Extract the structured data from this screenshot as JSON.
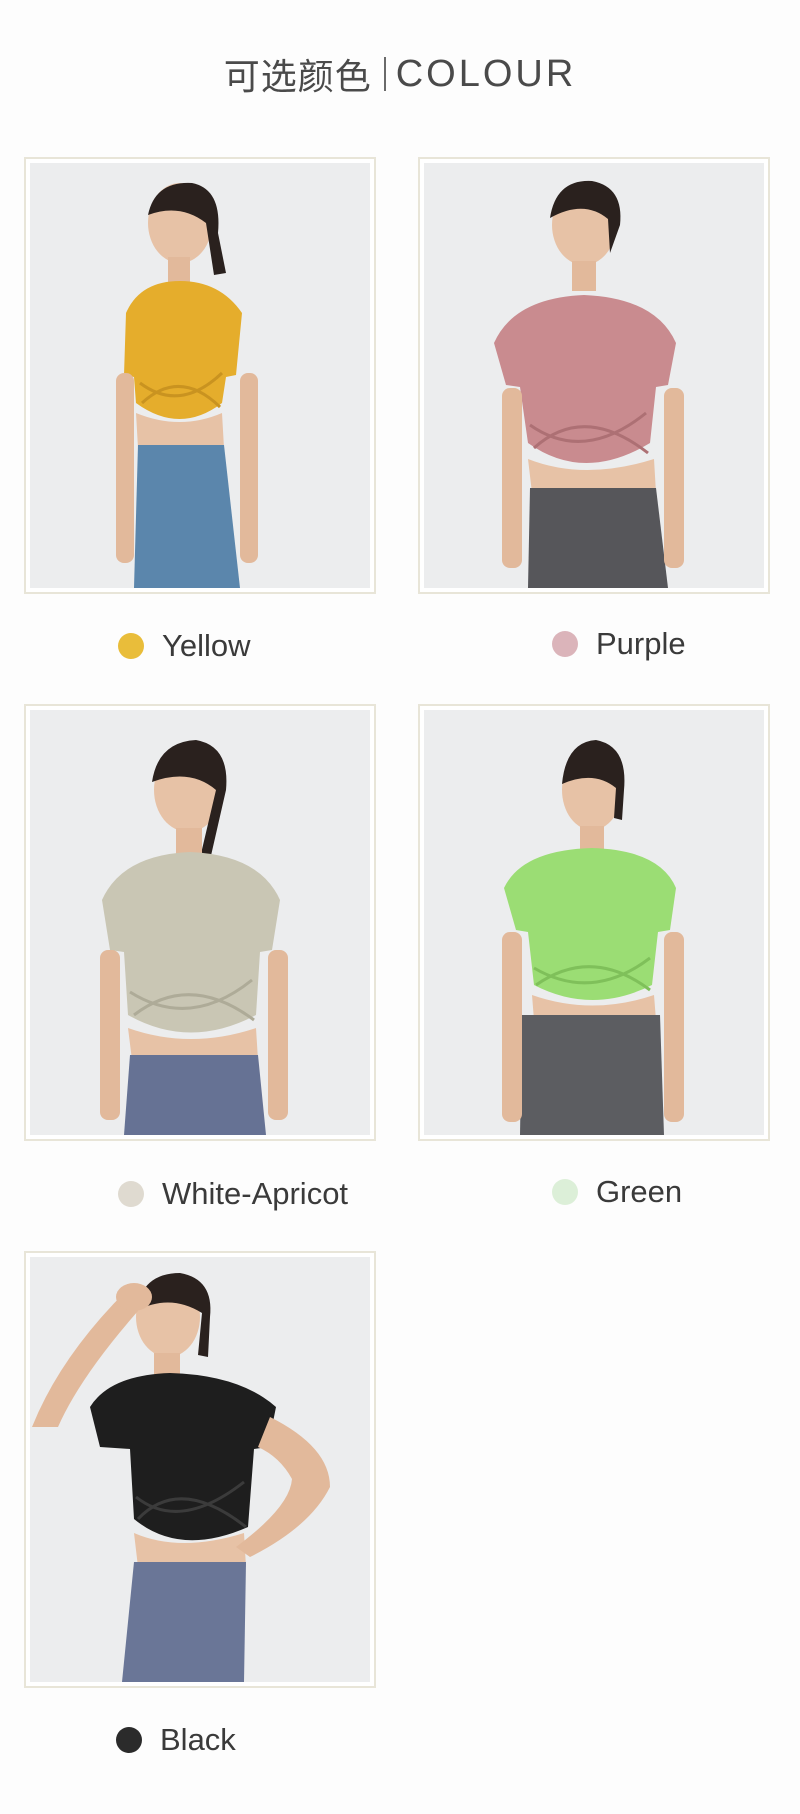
{
  "header": {
    "title_cn": "可选颜色",
    "title_en": "COLOUR"
  },
  "colors": [
    {
      "name": "Yellow",
      "dot": "#e9bd3a",
      "shirt": "#e5ad2c",
      "pants": "#5b86ac",
      "bg": "#ecedee"
    },
    {
      "name": "Purple",
      "dot": "#dbb4ba",
      "shirt": "#c98b8f",
      "pants": "#56565a",
      "bg": "#ecedee"
    },
    {
      "name": "White-Apricot",
      "dot": "#dfdad0",
      "shirt": "#c9c6b4",
      "pants": "#667294",
      "bg": "#ecedee"
    },
    {
      "name": "Green",
      "dot": "#dcefd8",
      "shirt": "#9bdd74",
      "pants": "#5c5d61",
      "bg": "#ecedee"
    },
    {
      "name": "Black",
      "dot": "#2b2b2b",
      "shirt": "#1e1e1e",
      "pants": "#6a7697",
      "bg": "#ecedee"
    }
  ]
}
